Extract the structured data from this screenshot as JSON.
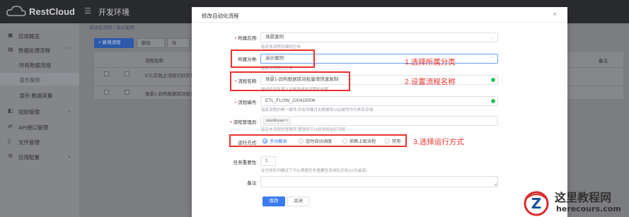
{
  "app": {
    "logo_text": "RestCloud",
    "env_title": "开发环境"
  },
  "sidebar": {
    "items": [
      {
        "label": "应用概览",
        "icon": "grid-icon"
      },
      {
        "label": "数据处理流程",
        "icon": "database-icon",
        "arrow": "⌃"
      },
      {
        "label": "所有数据流程"
      },
      {
        "label": "演示案例"
      },
      {
        "label": "演示-数据采集"
      },
      {
        "label": "规则管理",
        "icon": "rule-icon",
        "arrow": "⌄"
      },
      {
        "label": "API接口管理",
        "icon": "api-icon"
      },
      {
        "label": "文件管理",
        "icon": "file-icon"
      },
      {
        "label": "应用配置",
        "icon": "settings-icon",
        "arrow": "⌄"
      }
    ]
  },
  "background": {
    "breadcrumb": "自动化流程 / 演示案例",
    "buttons": {
      "new": "+ 新增流程",
      "delete": "删除",
      "export": "导"
    },
    "table": {
      "header_name": "流程名称",
      "header_note": "备注",
      "rows": [
        "ETL实践之流程识别实现",
        "场景1-异构数据库间批实现"
      ]
    }
  },
  "modal": {
    "title": "修改自动化流程",
    "close": "×",
    "fields": {
      "app": {
        "label": "所属应用:",
        "value": "场景案例",
        "hint": "指定本流程所属的应用"
      },
      "category": {
        "label": "所属分类:",
        "value": "演示案例",
        "hint": "指定本流程的分类"
      },
      "name": {
        "label": "流程名称:",
        "value": "场景1-异构数据库间批量增快速复制",
        "hint": "描述任何有意义且能描述本流程的说明"
      },
      "code": {
        "label": "流程编号:",
        "value": "ETL_FLOW_220415006",
        "hint": "指定流程的唯一编号,所有传输日志数据将以此编号作为表名存储"
      },
      "admin": {
        "label": "流程管理员:",
        "tag": "xiaolinyao",
        "tag_close": "×",
        "hint": "指定本流程的管理员,管理员可以修改和监控流程"
      },
      "run_mode": {
        "label": "运行方式:",
        "options": [
          {
            "label": "手动触发",
            "selected": true
          },
          {
            "label": "定时自动调度",
            "selected": false
          },
          {
            "label": "依赖上级流程",
            "selected": false
          },
          {
            "label": "禁用",
            "selected": false
          }
        ]
      },
      "priority": {
        "label": "任务重要性:",
        "value": "1",
        "hint": "在任务队列模式下可以根据任务重要性来排队任务(10为最高)"
      },
      "note": {
        "label": "备注:",
        "value": ""
      }
    },
    "buttons": {
      "save": "保存",
      "close": "关闭"
    }
  },
  "annotations": [
    {
      "text": "1.选择所属分类"
    },
    {
      "text": "2.设置流程名称"
    },
    {
      "text": "3.选择运行方式"
    }
  ],
  "watermark": {
    "title": "这里教程网",
    "url": "herecours.com",
    "logo_letter": "Z"
  },
  "colors": {
    "primary": "#3b7cf0",
    "annotation": "#e8322d",
    "required": "#e33333",
    "valid": "#2ec15a"
  }
}
